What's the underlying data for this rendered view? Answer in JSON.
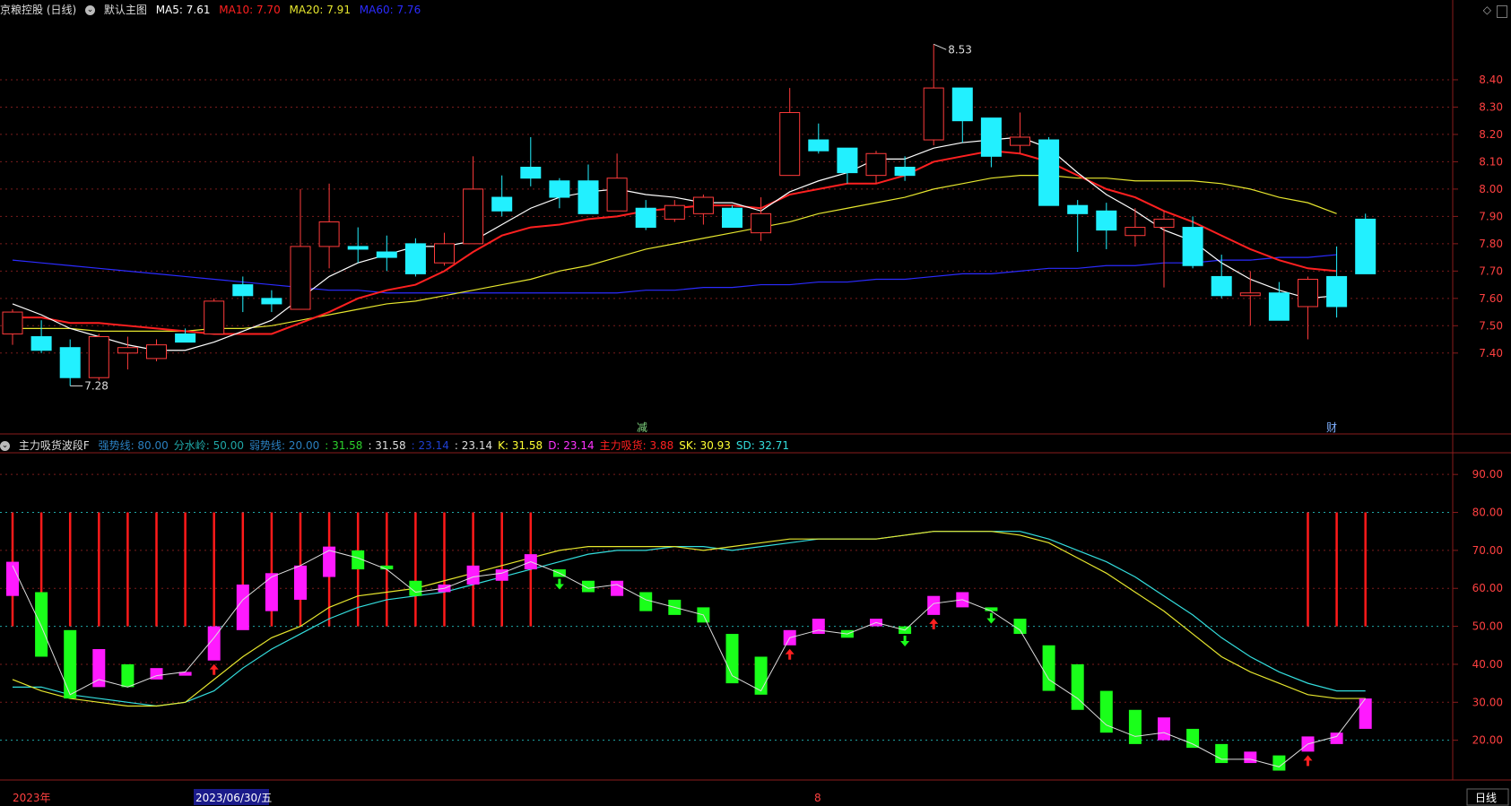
{
  "main_header": {
    "title": "京粮控股 (日线)",
    "template": "默认主图",
    "ma5_label": "MA5: 7.61",
    "ma10_label": "MA10: 7.70",
    "ma20_label": "MA20: 7.91",
    "ma60_label": "MA60: 7.76"
  },
  "sub_header": {
    "title": "主力吸货波段F",
    "items": [
      {
        "text": "强势线: 80.00",
        "color": "#2a7fbf"
      },
      {
        "text": "分水岭: 50.00",
        "color": "#1fa6a6"
      },
      {
        "text": "弱势线: 20.00",
        "color": "#2a7fbf"
      },
      {
        "text": ": 31.58",
        "color": "#2cd12c"
      },
      {
        "text": ": 31.58",
        "color": "#dddddd"
      },
      {
        "text": ": 23.14",
        "color": "#1f3fd0"
      },
      {
        "text": ": 23.14",
        "color": "#dddddd"
      },
      {
        "text": "K: 31.58",
        "color": "#ffff33"
      },
      {
        "text": "D: 23.14",
        "color": "#ff33ff"
      },
      {
        "text": "主力吸货: 3.88",
        "color": "#ff2020"
      },
      {
        "text": "SK: 30.93",
        "color": "#ffff33"
      },
      {
        "text": "SD: 32.71",
        "color": "#33dddd"
      }
    ]
  },
  "markers": {
    "jian": "减",
    "cai": "财"
  },
  "bottom_axis": {
    "year": "2023年",
    "cursor_date": "2023/06/30/五",
    "month": "8",
    "period": "日线"
  },
  "colors": {
    "up": "#ff3b3b",
    "down": "#22f0ff",
    "ma5": "#ffffff",
    "ma10": "#ff2020",
    "ma20": "#e6e62e",
    "ma60": "#2b2bff",
    "grid": "#7a1c1c",
    "bg": "#000000"
  },
  "chart_data": [
    {
      "type": "candlestick",
      "title": "京粮控股 (日线)",
      "ylim": [
        7.15,
        8.6
      ],
      "yticks": [
        7.4,
        7.5,
        7.6,
        7.7,
        7.8,
        7.9,
        8.0,
        8.1,
        8.2,
        8.3,
        8.4
      ],
      "annotations": [
        {
          "text": "8.53",
          "index": 32
        },
        {
          "text": "7.28",
          "index": 2
        }
      ],
      "candles": [
        {
          "o": 7.47,
          "h": 7.56,
          "l": 7.43,
          "c": 7.55
        },
        {
          "o": 7.46,
          "h": 7.52,
          "l": 7.4,
          "c": 7.41
        },
        {
          "o": 7.42,
          "h": 7.45,
          "l": 7.28,
          "c": 7.31
        },
        {
          "o": 7.31,
          "h": 7.47,
          "l": 7.3,
          "c": 7.46
        },
        {
          "o": 7.4,
          "h": 7.46,
          "l": 7.34,
          "c": 7.42
        },
        {
          "o": 7.38,
          "h": 7.45,
          "l": 7.37,
          "c": 7.43
        },
        {
          "o": 7.47,
          "h": 7.49,
          "l": 7.44,
          "c": 7.44
        },
        {
          "o": 7.47,
          "h": 7.6,
          "l": 7.47,
          "c": 7.59
        },
        {
          "o": 7.65,
          "h": 7.68,
          "l": 7.55,
          "c": 7.61
        },
        {
          "o": 7.6,
          "h": 7.63,
          "l": 7.55,
          "c": 7.58
        },
        {
          "o": 7.56,
          "h": 8.0,
          "l": 7.56,
          "c": 7.79
        },
        {
          "o": 7.79,
          "h": 8.02,
          "l": 7.71,
          "c": 7.88
        },
        {
          "o": 7.79,
          "h": 7.86,
          "l": 7.73,
          "c": 7.78
        },
        {
          "o": 7.77,
          "h": 7.83,
          "l": 7.7,
          "c": 7.75
        },
        {
          "o": 7.8,
          "h": 7.82,
          "l": 7.68,
          "c": 7.69
        },
        {
          "o": 7.73,
          "h": 7.84,
          "l": 7.72,
          "c": 7.8
        },
        {
          "o": 7.8,
          "h": 8.12,
          "l": 7.8,
          "c": 8.0
        },
        {
          "o": 7.97,
          "h": 8.05,
          "l": 7.9,
          "c": 7.92
        },
        {
          "o": 8.08,
          "h": 8.19,
          "l": 8.01,
          "c": 8.04
        },
        {
          "o": 8.03,
          "h": 8.04,
          "l": 7.93,
          "c": 7.97
        },
        {
          "o": 8.03,
          "h": 8.09,
          "l": 7.91,
          "c": 7.91
        },
        {
          "o": 7.92,
          "h": 8.13,
          "l": 7.92,
          "c": 8.04
        },
        {
          "o": 7.93,
          "h": 7.96,
          "l": 7.85,
          "c": 7.86
        },
        {
          "o": 7.89,
          "h": 7.96,
          "l": 7.88,
          "c": 7.94
        },
        {
          "o": 7.91,
          "h": 7.98,
          "l": 7.87,
          "c": 7.97
        },
        {
          "o": 7.93,
          "h": 7.94,
          "l": 7.86,
          "c": 7.86
        },
        {
          "o": 7.84,
          "h": 7.97,
          "l": 7.81,
          "c": 7.91
        },
        {
          "o": 8.05,
          "h": 8.37,
          "l": 8.05,
          "c": 8.28
        },
        {
          "o": 8.18,
          "h": 8.24,
          "l": 8.13,
          "c": 8.14
        },
        {
          "o": 8.15,
          "h": 8.15,
          "l": 8.02,
          "c": 8.06
        },
        {
          "o": 8.05,
          "h": 8.14,
          "l": 8.02,
          "c": 8.13
        },
        {
          "o": 8.08,
          "h": 8.12,
          "l": 8.03,
          "c": 8.05
        },
        {
          "o": 8.18,
          "h": 8.53,
          "l": 8.16,
          "c": 8.37
        },
        {
          "o": 8.37,
          "h": 8.37,
          "l": 8.17,
          "c": 8.25
        },
        {
          "o": 8.26,
          "h": 8.26,
          "l": 8.08,
          "c": 8.12
        },
        {
          "o": 8.16,
          "h": 8.28,
          "l": 8.13,
          "c": 8.19
        },
        {
          "o": 8.18,
          "h": 8.19,
          "l": 7.94,
          "c": 7.94
        },
        {
          "o": 7.94,
          "h": 7.96,
          "l": 7.77,
          "c": 7.91
        },
        {
          "o": 7.92,
          "h": 7.95,
          "l": 7.78,
          "c": 7.85
        },
        {
          "o": 7.83,
          "h": 7.93,
          "l": 7.79,
          "c": 7.86
        },
        {
          "o": 7.86,
          "h": 7.92,
          "l": 7.64,
          "c": 7.89
        },
        {
          "o": 7.86,
          "h": 7.9,
          "l": 7.71,
          "c": 7.72
        },
        {
          "o": 7.68,
          "h": 7.76,
          "l": 7.6,
          "c": 7.61
        },
        {
          "o": 7.61,
          "h": 7.7,
          "l": 7.5,
          "c": 7.62
        },
        {
          "o": 7.62,
          "h": 7.66,
          "l": 7.52,
          "c": 7.52
        },
        {
          "o": 7.57,
          "h": 7.68,
          "l": 7.45,
          "c": 7.67
        },
        {
          "o": 7.68,
          "h": 7.79,
          "l": 7.53,
          "c": 7.57
        },
        {
          "o": 7.89,
          "h": 7.91,
          "l": 7.7,
          "c": 7.69
        }
      ],
      "series": [
        {
          "name": "MA5",
          "values": [
            7.58,
            7.54,
            7.49,
            7.46,
            7.43,
            7.41,
            7.41,
            7.44,
            7.48,
            7.52,
            7.6,
            7.68,
            7.73,
            7.76,
            7.79,
            7.79,
            7.81,
            7.87,
            7.93,
            7.97,
            7.99,
            8.0,
            7.98,
            7.97,
            7.95,
            7.95,
            7.92,
            7.99,
            8.03,
            8.06,
            8.11,
            8.11,
            8.15,
            8.17,
            8.18,
            8.19,
            8.15,
            8.06,
            7.98,
            7.92,
            7.85,
            7.81,
            7.73,
            7.67,
            7.63,
            7.6,
            7.61
          ]
        },
        {
          "name": "MA10",
          "values": [
            7.53,
            7.53,
            7.51,
            7.51,
            7.5,
            7.49,
            7.48,
            7.47,
            7.47,
            7.47,
            7.51,
            7.55,
            7.6,
            7.63,
            7.65,
            7.7,
            7.77,
            7.83,
            7.86,
            7.87,
            7.89,
            7.9,
            7.92,
            7.93,
            7.94,
            7.94,
            7.93,
            7.98,
            8.0,
            8.02,
            8.02,
            8.05,
            8.1,
            8.12,
            8.14,
            8.13,
            8.1,
            8.05,
            8.0,
            7.97,
            7.92,
            7.88,
            7.83,
            7.78,
            7.74,
            7.71,
            7.7
          ]
        },
        {
          "name": "MA20",
          "values": [
            7.49,
            7.49,
            7.49,
            7.48,
            7.48,
            7.48,
            7.48,
            7.49,
            7.49,
            7.5,
            7.52,
            7.54,
            7.56,
            7.58,
            7.59,
            7.61,
            7.63,
            7.65,
            7.67,
            7.7,
            7.72,
            7.75,
            7.78,
            7.8,
            7.82,
            7.84,
            7.86,
            7.88,
            7.91,
            7.93,
            7.95,
            7.97,
            8.0,
            8.02,
            8.04,
            8.05,
            8.05,
            8.04,
            8.04,
            8.03,
            8.03,
            8.03,
            8.02,
            8.0,
            7.97,
            7.95,
            7.91
          ]
        },
        {
          "name": "MA60",
          "values": [
            7.74,
            7.73,
            7.72,
            7.71,
            7.7,
            7.69,
            7.68,
            7.67,
            7.66,
            7.65,
            7.64,
            7.63,
            7.63,
            7.62,
            7.62,
            7.62,
            7.62,
            7.62,
            7.62,
            7.62,
            7.62,
            7.62,
            7.63,
            7.63,
            7.64,
            7.64,
            7.65,
            7.65,
            7.66,
            7.66,
            7.67,
            7.67,
            7.68,
            7.69,
            7.69,
            7.7,
            7.71,
            7.71,
            7.72,
            7.72,
            7.73,
            7.73,
            7.74,
            7.74,
            7.75,
            7.75,
            7.76
          ]
        }
      ]
    },
    {
      "type": "bar",
      "title": "主力吸货波段F",
      "ylim": [
        10,
        95
      ],
      "yticks": [
        20,
        30,
        40,
        50,
        60,
        70,
        80,
        90
      ],
      "reference_lines": [
        80,
        50,
        20
      ],
      "kbars": [
        [
          58,
          67
        ],
        [
          42,
          59
        ],
        [
          31,
          49
        ],
        [
          34,
          44
        ],
        [
          34,
          40
        ],
        [
          36,
          39
        ],
        [
          37,
          38
        ],
        [
          41,
          50
        ],
        [
          49,
          61
        ],
        [
          54,
          64
        ],
        [
          57,
          66
        ],
        [
          63,
          71
        ],
        [
          65,
          70
        ],
        [
          65,
          66
        ],
        [
          58,
          62
        ],
        [
          59,
          61
        ],
        [
          61,
          66
        ],
        [
          62,
          65
        ],
        [
          65,
          69
        ],
        [
          63,
          65
        ],
        [
          59,
          62
        ],
        [
          58,
          62
        ],
        [
          54,
          59
        ],
        [
          53,
          57
        ],
        [
          51,
          55
        ],
        [
          35,
          48
        ],
        [
          32,
          42
        ],
        [
          45,
          49
        ],
        [
          48,
          52
        ],
        [
          47,
          49
        ],
        [
          50,
          52
        ],
        [
          48,
          50
        ],
        [
          53,
          58
        ],
        [
          55,
          59
        ],
        [
          54,
          55
        ],
        [
          48,
          52
        ],
        [
          33,
          45
        ],
        [
          28,
          40
        ],
        [
          22,
          33
        ],
        [
          19,
          28
        ],
        [
          20,
          26
        ],
        [
          18,
          23
        ],
        [
          14,
          19
        ],
        [
          14,
          17
        ],
        [
          12,
          16
        ],
        [
          17,
          21
        ],
        [
          19,
          22
        ],
        [
          23,
          31
        ]
      ],
      "k": [
        66,
        50,
        32,
        36,
        34,
        37,
        38,
        47,
        57,
        63,
        66,
        70,
        68,
        65,
        59,
        60,
        63,
        64,
        67,
        64,
        60,
        61,
        57,
        55,
        53,
        37,
        33,
        47,
        49,
        48,
        51,
        49,
        56,
        57,
        54,
        49,
        36,
        31,
        24,
        21,
        22,
        19,
        15,
        15,
        13,
        19,
        21,
        31
      ],
      "d": [
        35,
        34,
        30,
        30,
        29,
        29,
        30,
        33,
        38,
        42,
        45,
        49,
        53,
        55,
        56,
        57,
        59,
        60,
        62,
        63,
        64,
        64,
        64,
        64,
        63,
        61,
        58,
        56,
        55,
        54,
        54,
        53,
        53,
        54,
        54,
        53,
        51,
        48,
        44,
        40,
        36,
        33,
        29,
        26,
        22,
        21,
        21,
        23
      ],
      "sk": [
        36,
        33,
        31,
        30,
        29,
        29,
        30,
        36,
        42,
        47,
        50,
        55,
        58,
        59,
        60,
        62,
        64,
        66,
        68,
        70,
        71,
        71,
        71,
        71,
        70,
        71,
        72,
        73,
        73,
        73,
        73,
        74,
        75,
        75,
        75,
        74,
        72,
        68,
        64,
        59,
        54,
        48,
        42,
        38,
        35,
        32,
        31,
        31
      ],
      "sd": [
        34,
        34,
        32,
        31,
        30,
        29,
        30,
        33,
        39,
        44,
        48,
        52,
        55,
        57,
        58,
        59,
        61,
        63,
        65,
        67,
        69,
        70,
        70,
        71,
        71,
        70,
        71,
        72,
        73,
        73,
        73,
        74,
        75,
        75,
        75,
        75,
        73,
        70,
        67,
        63,
        58,
        53,
        47,
        42,
        38,
        35,
        33,
        33
      ],
      "red_signal_indices": [
        0,
        1,
        2,
        3,
        4,
        5,
        6,
        7,
        8,
        9,
        10,
        11,
        12,
        13,
        14,
        15,
        16,
        17,
        18,
        45,
        46,
        47
      ],
      "up_arrow_indices": [
        7,
        27,
        32,
        45
      ],
      "down_arrow_indices": [
        19,
        31,
        34
      ]
    }
  ]
}
